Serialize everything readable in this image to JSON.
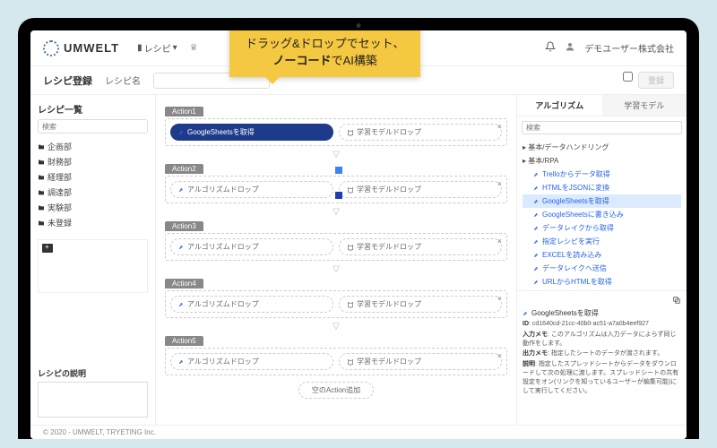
{
  "callout": {
    "line1": "ドラッグ&ドロップでセット、",
    "bold": "ノーコード",
    "line2_rest": "でAI構築"
  },
  "brand": "UMWELT",
  "nav": {
    "recipe": "レシピ",
    "icon2": "▽"
  },
  "user": "デモユーザー株式会社",
  "subbar": {
    "title": "レシピ登録",
    "name_label": "レシピ名",
    "register": "登録"
  },
  "left": {
    "hdr": "レシピ一覧",
    "search_ph": "検索",
    "folders": [
      "企画部",
      "財務部",
      "経理部",
      "調達部",
      "実験部",
      "未登録"
    ],
    "desc_label": "レシピの説明"
  },
  "actions": [
    {
      "tab": "Action1",
      "left": "GoogleSheetsを取得",
      "left_filled": true,
      "right": "学習モデルドロップ"
    },
    {
      "tab": "Action2",
      "left": "アルゴリズムドロップ",
      "left_filled": false,
      "right": "学習モデルドロップ"
    },
    {
      "tab": "Action3",
      "left": "アルゴリズムドロップ",
      "left_filled": false,
      "right": "学習モデルドロップ"
    },
    {
      "tab": "Action4",
      "left": "アルゴリズムドロップ",
      "left_filled": false,
      "right": "学習モデルドロップ"
    },
    {
      "tab": "Action5",
      "left": "アルゴリズムドロップ",
      "left_filled": false,
      "right": "学習モデルドロップ"
    }
  ],
  "add_action": "空のAction追加",
  "right": {
    "tabs": [
      "アルゴリズム",
      "学習モデル"
    ],
    "search_ph": "検索",
    "groups": [
      {
        "name": "基本/データハンドリング"
      },
      {
        "name": "基本/RPA",
        "items": [
          "Trelloからデータ取得",
          "HTMLをJSONに変換",
          "GoogleSheetsを取得",
          "GoogleSheetsに書き込み",
          "データレイクから取得",
          "指定レシピを実行",
          "EXCELを読み込み",
          "データレイクへ送信",
          "URLからHTMLを取得"
        ],
        "selected": 2
      }
    ],
    "detail": {
      "title": "GoogleSheetsを取得",
      "id_label": "ID",
      "id": "cd1640cd-21cc-40b0-ac51-a7a0b4eef927",
      "in_label": "入力メモ",
      "in": "このアルゴリズムは入力データによらず同じ動作をします。",
      "out_label": "出力メモ",
      "out": "指定したシートのデータが渡されます。",
      "desc_label": "説明",
      "desc": "指定したスプレッドシートからデータをダウンロードして次の処理に渡します。スプレッドシートの共有設定をオン(リンクを知っているユーザーが編集可能)にして実行してください。"
    }
  },
  "footer": "© 2020 - UMWELT, TRYETING Inc."
}
